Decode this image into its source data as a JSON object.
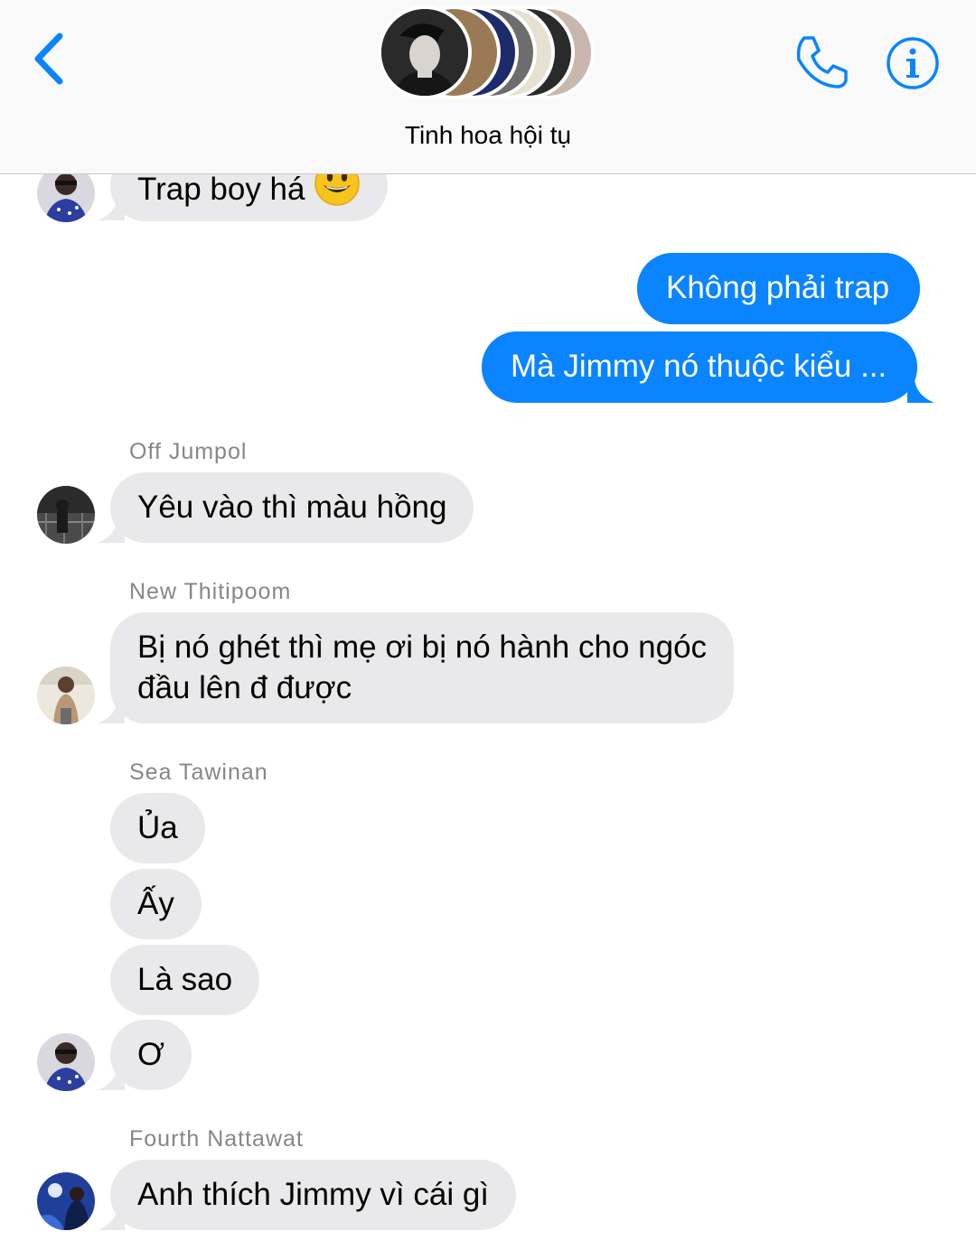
{
  "header": {
    "title": "Tinh hoa hội tụ",
    "accent_color": "#0a84ff",
    "icons": [
      "chevron-left-icon",
      "phone-icon",
      "info-icon"
    ]
  },
  "messages": {
    "m1": {
      "text": "Trap boy há",
      "emoji": "grinning-face"
    },
    "m2": {
      "text": "Không phải trap"
    },
    "m3": {
      "text": "Mà Jimmy nó thuộc kiểu ..."
    },
    "off_name": "Off Jumpol",
    "m4": {
      "text": "Yêu vào thì màu hồng"
    },
    "new_name": "New Thitipoom",
    "m5": {
      "line1": "Bị nó ghét thì mẹ ơi bị nó hành cho ngóc",
      "line2": "đầu lên đ được"
    },
    "sea_name": "Sea Tawinan",
    "m6": {
      "text": "Ủa"
    },
    "m7": {
      "text": "Ấy"
    },
    "m8": {
      "text": "Là sao"
    },
    "m9": {
      "text": "Ơ"
    },
    "fourth_name": "Fourth Nattawat",
    "m10": {
      "text": "Anh thích Jimmy vì cái gì"
    }
  },
  "colors": {
    "outgoing_bubble": "#0a84ff",
    "incoming_bubble": "#e9e9eb",
    "sender_name": "#86868b"
  }
}
